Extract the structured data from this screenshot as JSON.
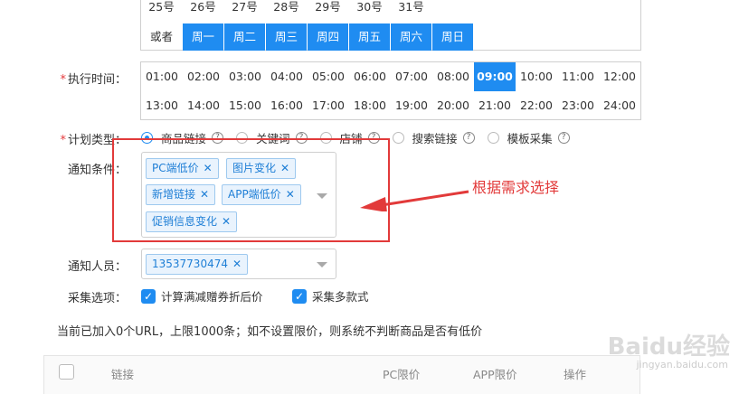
{
  "days": [
    "25号",
    "26号",
    "27号",
    "28号",
    "29号",
    "30号",
    "31号"
  ],
  "weekdays": {
    "or_label": "或者",
    "items": [
      "周一",
      "周二",
      "周三",
      "周四",
      "周五",
      "周六",
      "周日"
    ]
  },
  "exec_time": {
    "label": "执行时间：",
    "row1": [
      "01:00",
      "02:00",
      "03:00",
      "04:00",
      "05:00",
      "06:00",
      "07:00",
      "08:00",
      "09:00",
      "10:00",
      "11:00",
      "12:00"
    ],
    "row2": [
      "13:00",
      "14:00",
      "15:00",
      "16:00",
      "17:00",
      "18:00",
      "19:00",
      "20:00",
      "21:00",
      "22:00",
      "23:00",
      "24:00"
    ],
    "selected": "09:00"
  },
  "plan_type": {
    "label": "计划类型：",
    "options": [
      "商品链接",
      "关键词",
      "店铺",
      "搜索链接",
      "模板采集"
    ],
    "selected": "商品链接"
  },
  "notify_conditions": {
    "label": "通知条件：",
    "tags": [
      "PC端低价",
      "图片变化",
      "新增链接",
      "APP端低价",
      "促销信息变化"
    ]
  },
  "notify_people": {
    "label": "通知人员：",
    "tags": [
      "13537730474"
    ]
  },
  "collect_options": {
    "label": "采集选项：",
    "items": [
      "计算满减赠券折后价",
      "采集多款式"
    ]
  },
  "annotation": "根据需求选择",
  "info_text": "当前已加入0个URL，上限1000条；如不设置限价，则系统不判断商品是否有低价",
  "table": {
    "headers": [
      "链接",
      "PC限价",
      "APP限价",
      "操作"
    ]
  },
  "watermark": {
    "main": "Baidu经验",
    "sub": "jingyan.baidu.com"
  },
  "colors": {
    "accent": "#1f8cf1",
    "annotation_red": "#e23a3a",
    "tag_bg": "#e9f3fd"
  }
}
